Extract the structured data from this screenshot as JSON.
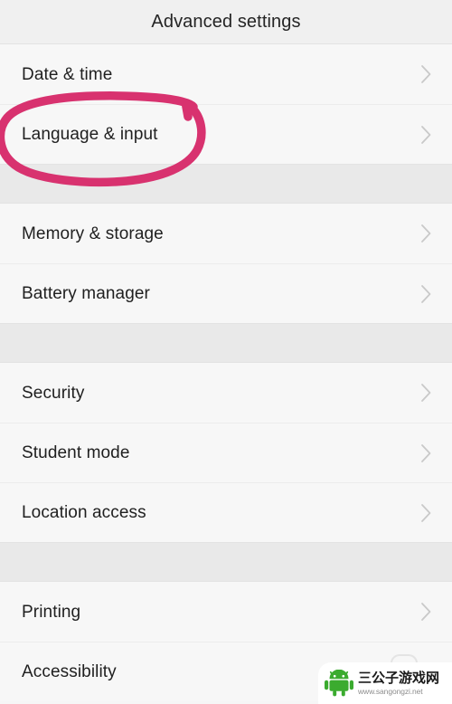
{
  "header": {
    "title": "Advanced settings"
  },
  "colors": {
    "header_bg": "#f0f0f0",
    "row_bg": "#f7f7f7",
    "gap_bg": "#e9e9e9",
    "text": "#1f1f1f",
    "chevron": "#c9c9c9",
    "annotation": "#d8326f",
    "watermark_green": "#3bab2f"
  },
  "list": {
    "groups": [
      {
        "items": [
          {
            "label": "Date & time",
            "chevron": "chevron-right-icon"
          },
          {
            "label": "Language & input",
            "chevron": "chevron-right-icon"
          }
        ]
      },
      {
        "items": [
          {
            "label": "Memory & storage",
            "chevron": "chevron-right-icon"
          },
          {
            "label": "Battery manager",
            "chevron": "chevron-right-icon"
          }
        ]
      },
      {
        "items": [
          {
            "label": "Security",
            "chevron": "chevron-right-icon"
          },
          {
            "label": "Student mode",
            "chevron": "chevron-right-icon"
          },
          {
            "label": "Location access",
            "chevron": "chevron-right-icon"
          }
        ]
      },
      {
        "items": [
          {
            "label": "Printing",
            "chevron": "chevron-right-icon"
          },
          {
            "label": "Accessibility",
            "chevron": "chevron-right-icon"
          }
        ]
      }
    ]
  },
  "annotation": {
    "type": "hand-drawn-ellipse",
    "target_label": "Language & input",
    "color": "#d8326f"
  },
  "watermark": {
    "site_name": "三公子游戏网",
    "url": "www.sangongzi.net",
    "logo": "android-robot-icon"
  }
}
